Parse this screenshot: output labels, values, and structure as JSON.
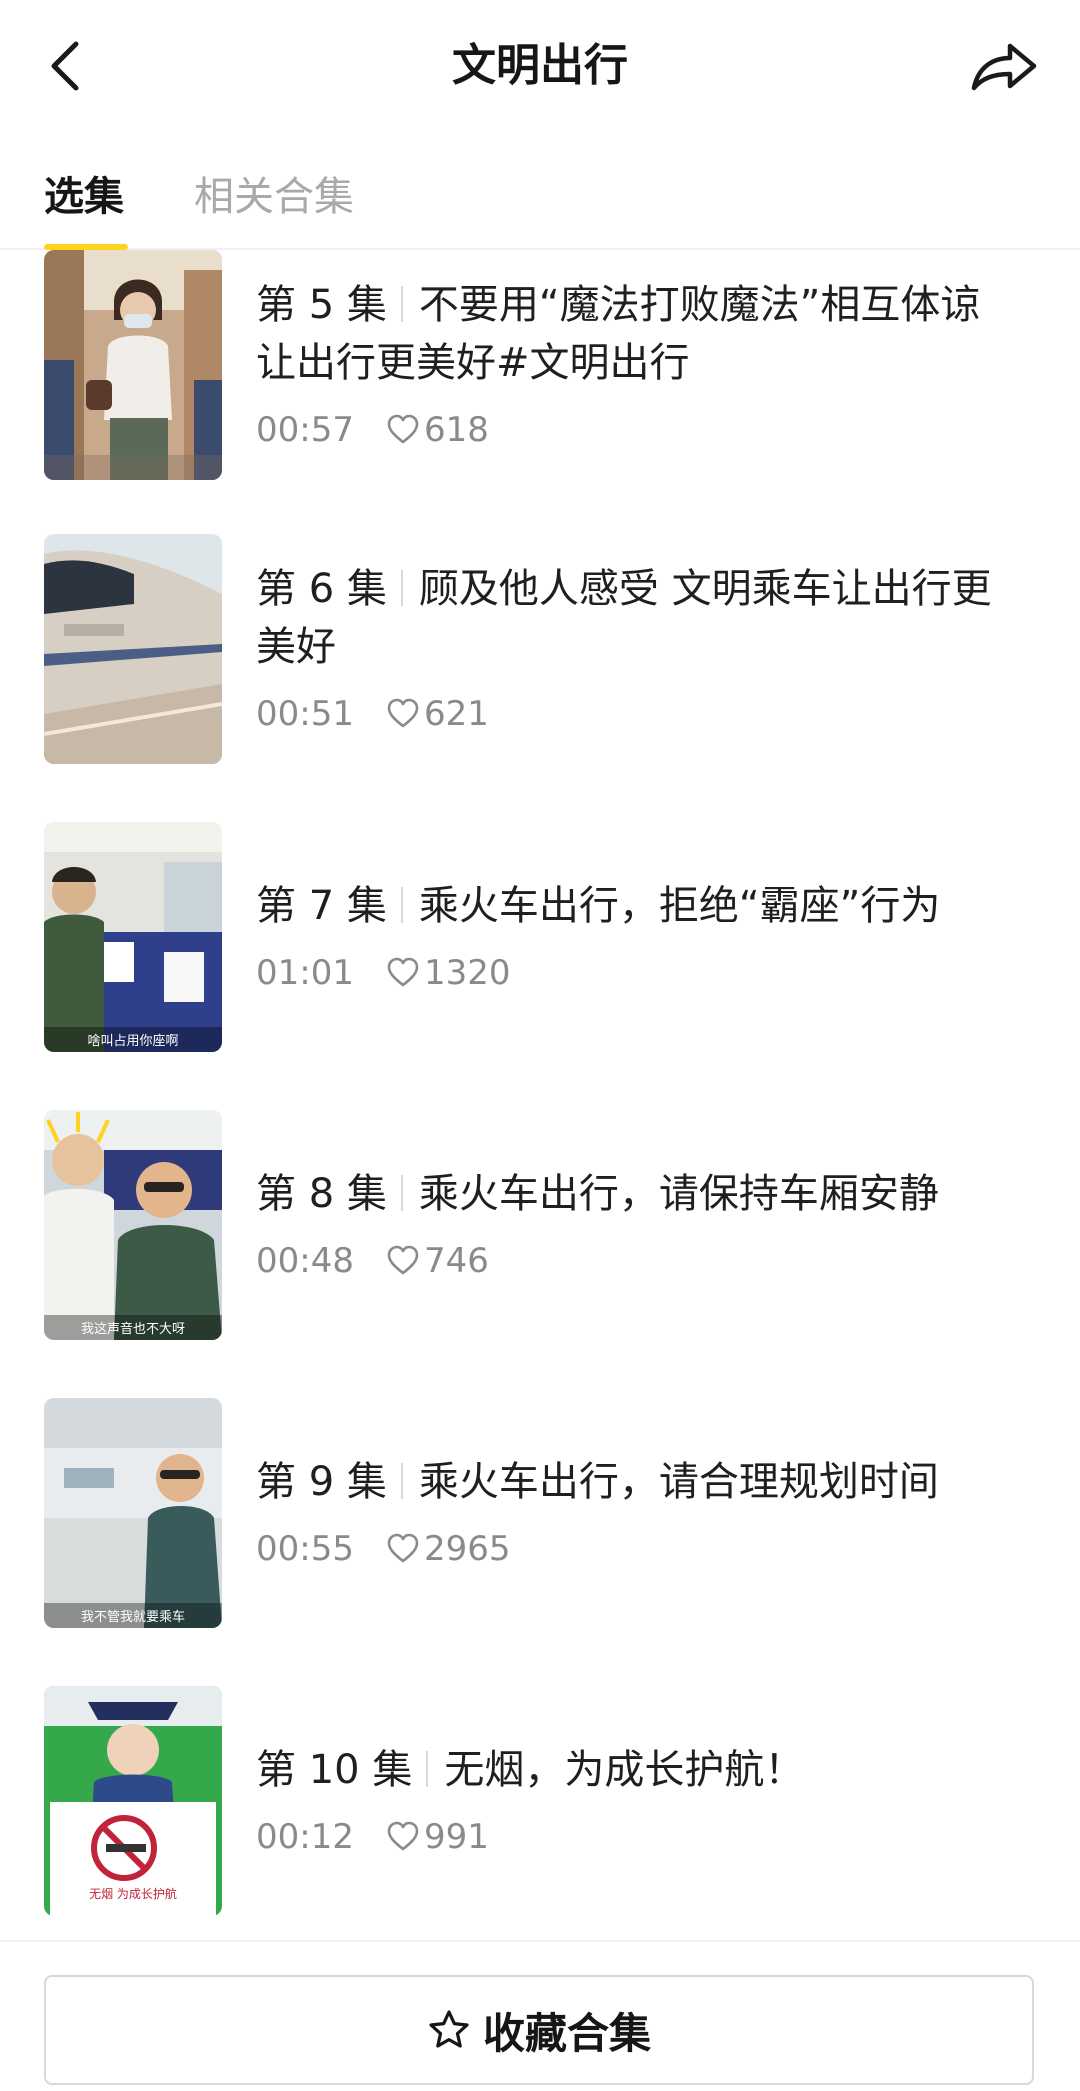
{
  "header": {
    "title": "文明出行"
  },
  "tabs": [
    {
      "label": "选集",
      "active": true
    },
    {
      "label": "相关合集",
      "active": false
    }
  ],
  "colors": {
    "accent": "#ffd21e",
    "text_primary": "#1f1f1f",
    "text_secondary": "#8a8a8a",
    "tab_inactive": "#a9a9a9"
  },
  "episodes": [
    {
      "episode": "第 5 集",
      "title_line1": "不要用“魔法打败魔法”相互体谅",
      "title_line2": "让出行更美好#文明出行",
      "duration": "00:57",
      "likes": "618",
      "thumbnail": "woman-on-train-thumbnail"
    },
    {
      "episode": "第 6 集",
      "title_line1": "顾及他人感受 文明乘车让出行更",
      "title_line2": "美好",
      "duration": "00:51",
      "likes": "621",
      "thumbnail": "high-speed-train-thumbnail"
    },
    {
      "episode": "第 7 集",
      "title_line1": "乘火车出行，拒绝“霸座”行为",
      "title_line2": "",
      "duration": "01:01",
      "likes": "1320",
      "thumbnail": "train-seats-thumbnail",
      "caption": "啥叫占用你座啊"
    },
    {
      "episode": "第 8 集",
      "title_line1": "乘火车出行，请保持车厢安静",
      "title_line2": "",
      "duration": "00:48",
      "likes": "746",
      "thumbnail": "two-men-train-thumbnail",
      "caption": "我这声音也不大呀"
    },
    {
      "episode": "第 9 集",
      "title_line1": "乘火车出行，请合理规划时间",
      "title_line2": "",
      "duration": "00:55",
      "likes": "2965",
      "thumbnail": "station-man-thumbnail",
      "caption": "我不管我就要乘车"
    },
    {
      "episode": "第 10 集",
      "title_line1": "无烟，为成长护航！",
      "title_line2": "",
      "duration": "00:12",
      "likes": "991",
      "thumbnail": "no-smoking-sign-thumbnail",
      "caption": "无烟 为成长护航"
    }
  ],
  "footer": {
    "collect_label": "收藏合集"
  }
}
